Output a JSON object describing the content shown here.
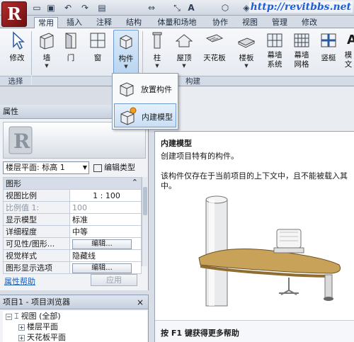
{
  "app": {
    "logo_letter": "R",
    "watermark_url": "http://revitbbs.net"
  },
  "quick_access": [
    "folder-open-icon",
    "save-icon",
    "undo-icon",
    "redo-icon",
    "print-icon",
    "measure-icon",
    "dimension-icon",
    "text-icon",
    "3d-view-icon",
    "section-icon"
  ],
  "tabs": [
    "常用",
    "插入",
    "注释",
    "结构",
    "体量和场地",
    "协作",
    "视图",
    "管理",
    "修改"
  ],
  "active_tab": "常用",
  "ribbon": {
    "buttons": [
      {
        "label": "修改",
        "has_arrow": false
      },
      {
        "label": "墙",
        "has_arrow": true
      },
      {
        "label": "门",
        "has_arrow": false
      },
      {
        "label": "窗",
        "has_arrow": false
      },
      {
        "label": "构件",
        "has_arrow": true,
        "selected": true
      },
      {
        "label": "柱",
        "has_arrow": true
      },
      {
        "label": "屋顶",
        "has_arrow": true
      },
      {
        "label": "天花板",
        "has_arrow": false
      },
      {
        "label": "楼板",
        "has_arrow": true
      },
      {
        "label": "幕墙",
        "label2": "系统"
      },
      {
        "label": "幕墙",
        "label2": "网格"
      },
      {
        "label": "竖梃",
        "has_arrow": false
      },
      {
        "label": "模",
        "label2": "文"
      }
    ],
    "groups": {
      "select": "选择",
      "build": "构建"
    }
  },
  "component_menu": {
    "items": [
      "放置构件",
      "内建模型"
    ],
    "highlighted": "内建模型"
  },
  "properties": {
    "title": "属性",
    "type_selector": "楼层平面: 标高 1",
    "edit_type": "编辑类型",
    "section": "图形",
    "rows": [
      {
        "name": "视图比例",
        "value": "1 : 100"
      },
      {
        "name": "比例值 1:",
        "value": "100",
        "dim": true
      },
      {
        "name": "显示模型",
        "value": "标准"
      },
      {
        "name": "详细程度",
        "value": "中等"
      },
      {
        "name": "可见性/图形...",
        "value": "编辑...",
        "button": true
      },
      {
        "name": "视觉样式",
        "value": "隐藏线"
      },
      {
        "name": "图形显示选项",
        "value": "编辑...",
        "button": true
      }
    ],
    "help_link": "属性帮助",
    "apply": "应用"
  },
  "project_browser": {
    "title": "项目1 - 项目浏览器",
    "close": "×",
    "nodes": [
      {
        "label": "视图 (全部)",
        "level": 0,
        "toggle": "−"
      },
      {
        "label": "楼层平面",
        "level": 1,
        "toggle": "+"
      },
      {
        "label": "天花板平面",
        "level": 1,
        "toggle": "+"
      }
    ]
  },
  "tooltip": {
    "title": "内建模型",
    "summary": "创建项目特有的构件。",
    "detail_line1": "该构件仅存在于当前项目的上下文中，且不能被载入其",
    "detail_line2": "中。",
    "footer": "按 F1 键获得更多帮助"
  }
}
